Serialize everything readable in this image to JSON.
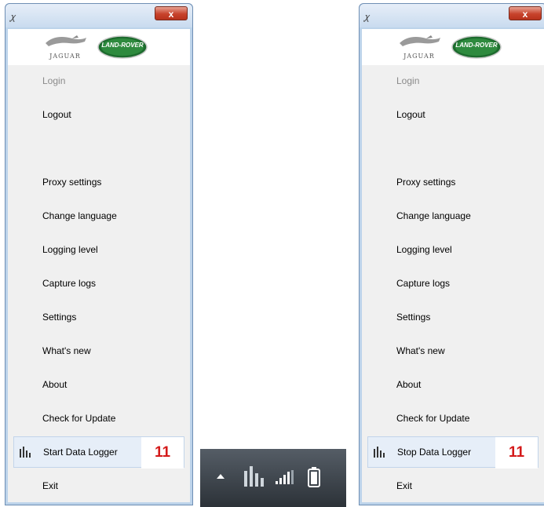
{
  "windows": [
    {
      "title_icon": "jlr-app-icon",
      "close_label": "x",
      "logos": {
        "jaguar_text": "JAGUAR",
        "landrover_text": "LAND-ROVER"
      },
      "menu": [
        {
          "label": "Login",
          "disabled": true
        },
        {
          "label": "Logout"
        },
        {
          "label": ""
        },
        {
          "label": "Proxy settings"
        },
        {
          "label": "Change language"
        },
        {
          "label": "Logging level"
        },
        {
          "label": "Capture logs"
        },
        {
          "label": "Settings"
        },
        {
          "label": "What's new"
        },
        {
          "label": "About"
        },
        {
          "label": "Check for Update"
        },
        {
          "label": "Start Data Logger",
          "icon": "bar-chart-icon",
          "badge": "11"
        },
        {
          "label": "Exit"
        }
      ]
    },
    {
      "title_icon": "jlr-app-icon",
      "close_label": "x",
      "logos": {
        "jaguar_text": "JAGUAR",
        "landrover_text": "LAND-ROVER"
      },
      "menu": [
        {
          "label": "Login",
          "disabled": true
        },
        {
          "label": "Logout"
        },
        {
          "label": ""
        },
        {
          "label": "Proxy settings"
        },
        {
          "label": "Change language"
        },
        {
          "label": "Logging level"
        },
        {
          "label": "Capture logs"
        },
        {
          "label": "Settings"
        },
        {
          "label": "What's new"
        },
        {
          "label": "About"
        },
        {
          "label": "Check for Update"
        },
        {
          "label": "Stop Data Logger",
          "icon": "bar-chart-icon",
          "badge": "11"
        },
        {
          "label": "Exit"
        }
      ]
    }
  ],
  "taskbar": {
    "icons": [
      "show-hidden-icons-arrow",
      "data-logger-tray-icon",
      "signal-strength-icon",
      "battery-icon"
    ]
  },
  "colors": {
    "accent_badge": "#d41a1a",
    "menu_bg": "#f0f0f0",
    "highlight_bg": "#e6eef8",
    "landrover_green": "#2e7d32",
    "taskbar_bg": "#2c3238"
  }
}
